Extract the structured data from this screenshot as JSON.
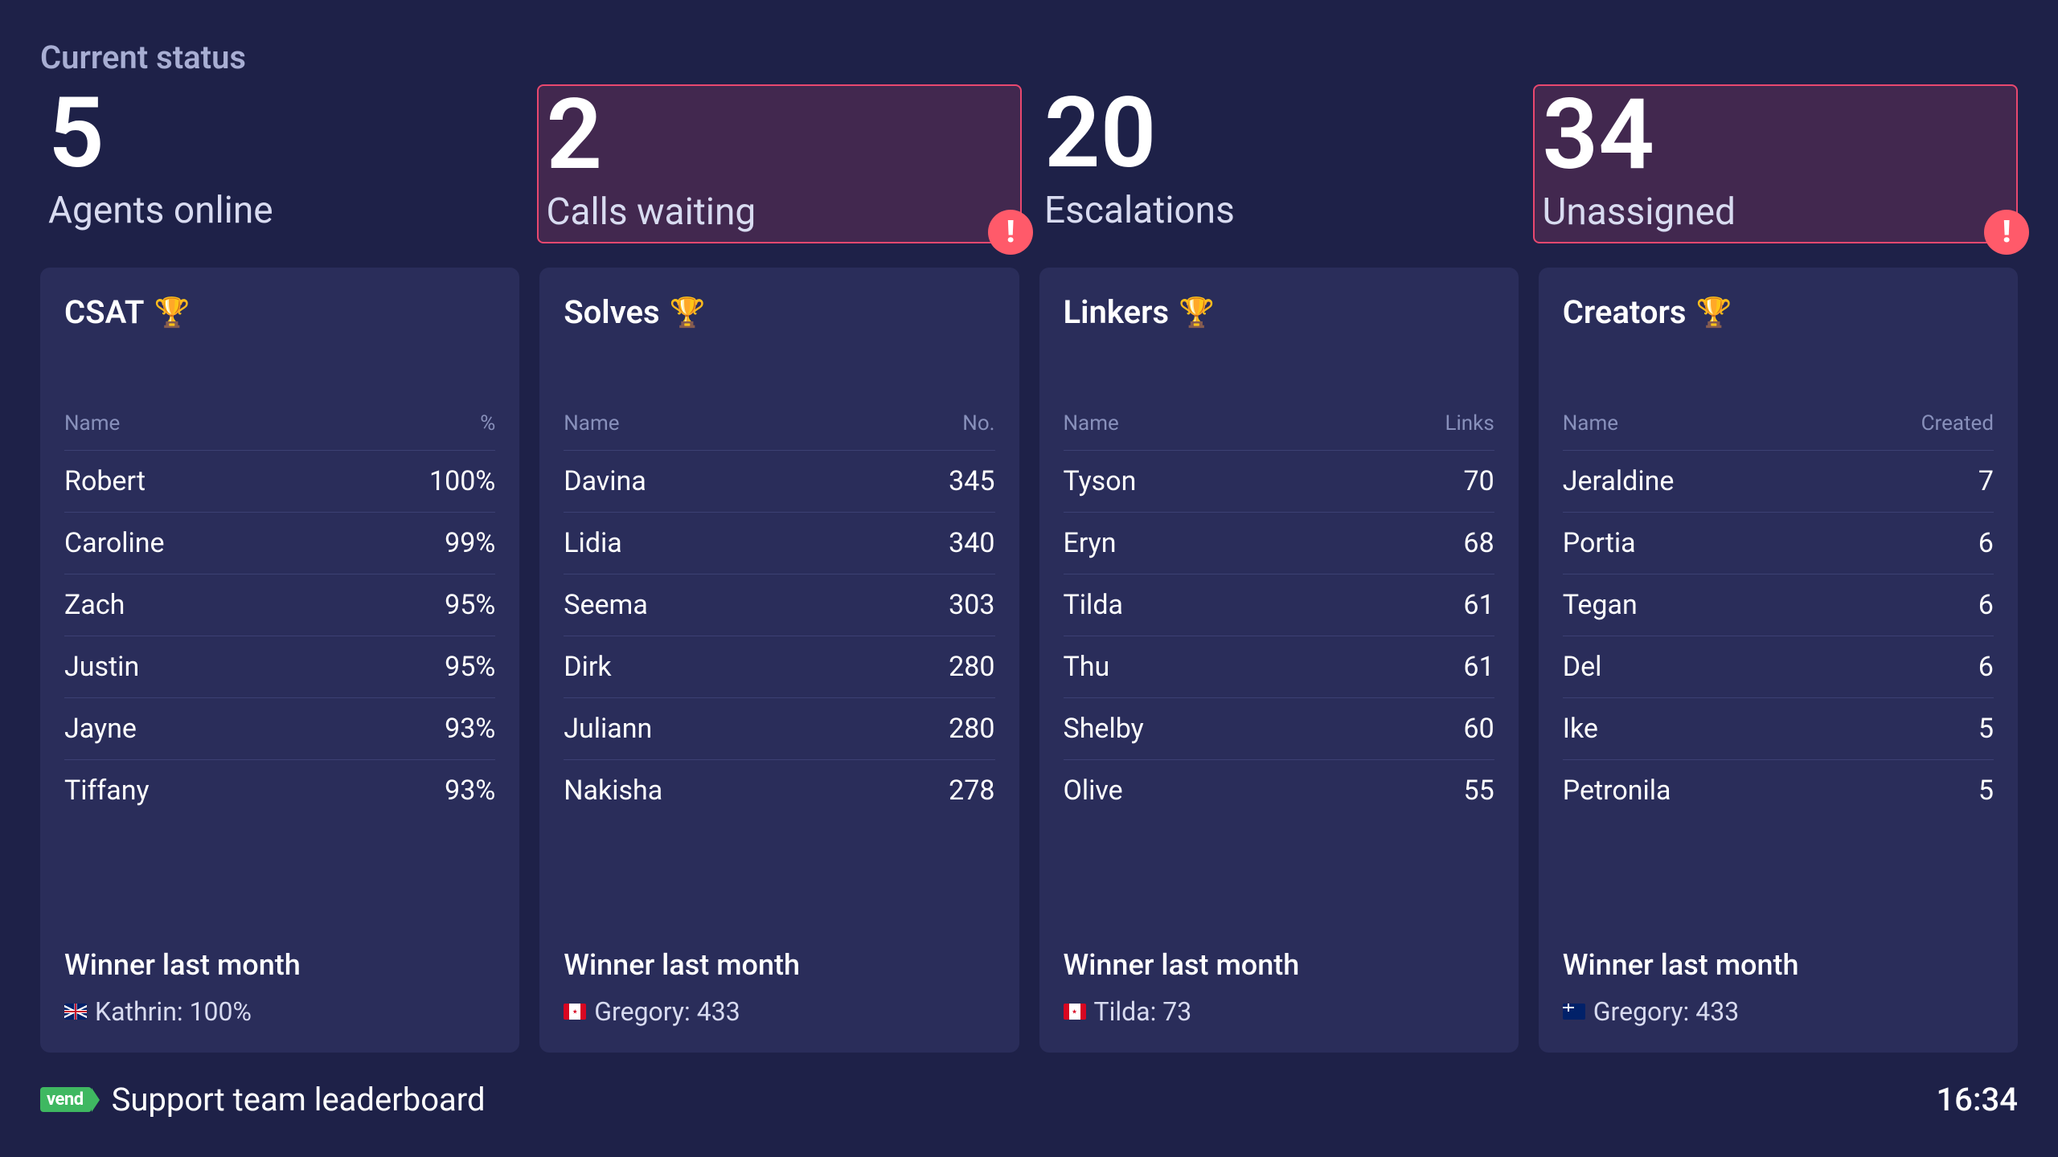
{
  "status": {
    "title": "Current status",
    "cards": [
      {
        "value": "5",
        "label": "Agents online",
        "alert": false
      },
      {
        "value": "2",
        "label": "Calls waiting",
        "alert": true
      },
      {
        "value": "20",
        "label": "Escalations",
        "alert": false
      },
      {
        "value": "34",
        "label": "Unassigned",
        "alert": true
      }
    ]
  },
  "boards": [
    {
      "title": "CSAT",
      "col1": "Name",
      "col2": "%",
      "rows": [
        {
          "name": "Robert",
          "value": "100%"
        },
        {
          "name": "Caroline",
          "value": "99%"
        },
        {
          "name": "Zach",
          "value": "95%"
        },
        {
          "name": "Justin",
          "value": "95%"
        },
        {
          "name": "Jayne",
          "value": "93%"
        },
        {
          "name": "Tiffany",
          "value": "93%"
        }
      ],
      "winner_label": "Winner last month",
      "winner_flag": "uk",
      "winner_text": "Kathrin: 100%"
    },
    {
      "title": "Solves",
      "col1": "Name",
      "col2": "No.",
      "rows": [
        {
          "name": "Davina",
          "value": "345"
        },
        {
          "name": "Lidia",
          "value": "340"
        },
        {
          "name": "Seema",
          "value": "303"
        },
        {
          "name": "Dirk",
          "value": "280"
        },
        {
          "name": "Juliann",
          "value": "280"
        },
        {
          "name": "Nakisha",
          "value": "278"
        }
      ],
      "winner_label": "Winner last month",
      "winner_flag": "ca",
      "winner_text": "Gregory: 433"
    },
    {
      "title": "Linkers",
      "col1": "Name",
      "col2": "Links",
      "rows": [
        {
          "name": "Tyson",
          "value": "70"
        },
        {
          "name": "Eryn",
          "value": "68"
        },
        {
          "name": "Tilda",
          "value": "61"
        },
        {
          "name": "Thu",
          "value": "61"
        },
        {
          "name": "Shelby",
          "value": "60"
        },
        {
          "name": "Olive",
          "value": "55"
        }
      ],
      "winner_label": "Winner last month",
      "winner_flag": "ca",
      "winner_text": "Tilda: 73"
    },
    {
      "title": "Creators",
      "col1": "Name",
      "col2": "Created",
      "rows": [
        {
          "name": "Jeraldine",
          "value": "7"
        },
        {
          "name": "Portia",
          "value": "6"
        },
        {
          "name": "Tegan",
          "value": "6"
        },
        {
          "name": "Del",
          "value": "6"
        },
        {
          "name": "Ike",
          "value": "5"
        },
        {
          "name": "Petronila",
          "value": "5"
        }
      ],
      "winner_label": "Winner last month",
      "winner_flag": "nz",
      "winner_text": "Gregory: 433"
    }
  ],
  "footer": {
    "logo": "vend",
    "title": "Support team leaderboard",
    "time": "16:34"
  }
}
